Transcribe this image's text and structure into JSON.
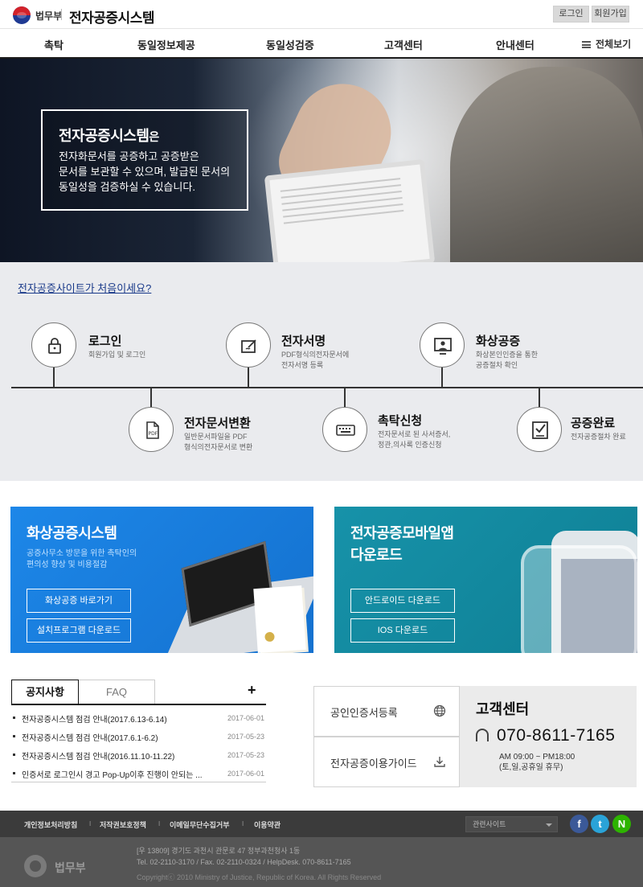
{
  "header": {
    "ministry": "법무부",
    "system_name": "전자공증시스템",
    "login": "로그인",
    "join": "회원가입"
  },
  "nav": {
    "items": [
      "촉탁",
      "동일정보제공",
      "동일성검증",
      "고객센터",
      "안내센터"
    ],
    "all_menu": "전체보기"
  },
  "hero": {
    "title": "전자공증시스템",
    "title_suffix": "은",
    "desc_line1": "전자화문서를 공증하고 공증받은",
    "desc_line2": "문서를 보관할 수 있으며, 발급된 문서의",
    "desc_line3": "동일성을 검증하실 수 있습니다."
  },
  "process": {
    "first_link": "전자공증사이트가 처음이세요?",
    "steps": [
      {
        "title": "로그인",
        "desc1": "회원가입 및 로그인",
        "desc2": "",
        "icon": "lock-icon"
      },
      {
        "title": "전자서명",
        "desc1": "PDF형식의전자문서에",
        "desc2": "전자서명 등록",
        "icon": "sign-icon"
      },
      {
        "title": "화상공증",
        "desc1": "화상본인인증을 통한",
        "desc2": "공증절차 확인",
        "icon": "monitor-icon"
      },
      {
        "title": "전자문서변환",
        "desc1": "일반문서파일을 PDF",
        "desc2": "형식의전자문서로 변환",
        "icon": "pdf-icon"
      },
      {
        "title": "촉탁신청",
        "desc1": "전자문서로 된 사서증서,",
        "desc2": "정관,의사록  인증신청",
        "icon": "keyboard-icon"
      },
      {
        "title": "공증완료",
        "desc1": "전자공증절차 완료",
        "desc2": "",
        "icon": "check-doc-icon"
      }
    ]
  },
  "banner_video": {
    "title": "화상공증시스템",
    "desc1": "공증사무소 방문을 위한 촉탁인의",
    "desc2": "편의성 향상 및 비용절감",
    "btn1": "화상공증 바로가기",
    "btn2": "설치프로그램 다운로드"
  },
  "banner_mobile": {
    "title1": "전자공증모바일앱",
    "title2": "다운로드",
    "btn1": "안드로이드 다운로드",
    "btn2": "IOS 다운로드"
  },
  "notice": {
    "tab_notice": "공지사항",
    "tab_faq": "FAQ",
    "more": "+",
    "items": [
      {
        "title": "전자공증시스템 점검 안내(2017.6.13-6.14)",
        "date": "2017-06-01"
      },
      {
        "title": "전자공증시스템 점검 안내(2017.6.1-6.2)",
        "date": "2017-05-23"
      },
      {
        "title": "전자공증시스템 점검 안내(2016.11.10-11.22)",
        "date": "2017-05-23"
      },
      {
        "title": "인증서로 로그인시 경고 Pop-Up이후 진행이 안되는 ...",
        "date": "2017-06-01"
      }
    ]
  },
  "services": {
    "cert": "공인인증서등록",
    "guide": "전자공증이용가이드"
  },
  "customer_center": {
    "title": "고객센터",
    "phone": "070-8611-7165",
    "hours": "AM 09:00 ~ PM18:00",
    "closed": "(토,일,공휴일 휴무)"
  },
  "footer": {
    "links": [
      "개인정보처리방침",
      "저작권보호정책",
      "이메일무단수집거부",
      "이용약관"
    ],
    "related": "관련사이트",
    "sns": {
      "facebook": "f",
      "twitter": "t",
      "naver": "N"
    },
    "ministry": "법무부",
    "address": "[우 13809] 경기도 과천시 관문로 47 정부과천청사 1동",
    "tel": "Tel. 02-2110-3170 / Fax. 02-2110-0324 / HelpDesk. 070-8611-7165",
    "copyright": "Copyrightⓒ 2010 Ministry of Justice, Republic of Korea. All Rights Reserved"
  },
  "colors": {
    "blue_banner": "#1d87e8",
    "teal_banner": "#1792a9",
    "facebook": "#3b5998",
    "twitter": "#2aa3d8",
    "naver": "#2db400"
  }
}
